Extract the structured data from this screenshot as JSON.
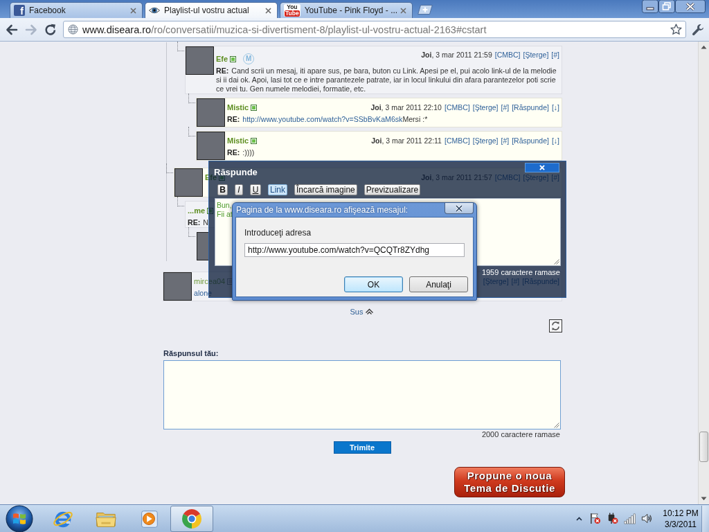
{
  "browser": {
    "tabs": [
      {
        "title": "Facebook",
        "selected": false,
        "favicon": {
          "kind": "letter",
          "text": "f"
        }
      },
      {
        "title": "Playlist-ul vostru actual",
        "selected": true,
        "favicon": {
          "kind": "eye"
        }
      },
      {
        "title": "YouTube - Pink Floyd - ...",
        "selected": false,
        "favicon": {
          "kind": "stacked",
          "lines": [
            "You",
            "Tube"
          ]
        }
      }
    ],
    "navigation": [
      {
        "kind": "back",
        "disabled": false
      },
      {
        "kind": "forward",
        "disabled": true
      },
      {
        "kind": "reload",
        "disabled": false
      }
    ],
    "address": {
      "host": "www.diseara.ro",
      "path": "/ro/conversatii/muzica-si-divertisment-8/playlist-ul-vostru-actual-2163#cstart"
    }
  },
  "thread": [
    {
      "kind": "continued",
      "children": [
        {
          "kind": "continued",
          "children": [
            {
              "kind": "comment",
              "avatar": true,
              "author": "Efe",
              "online": true,
              "badge": "M",
              "date": "**Joi**, 3 mar 2011 21:59",
              "links": [
                "[CMBC]",
                "[Şterge]",
                "[#]"
              ],
              "body": {
                "prefix": "RE:",
                "text": "Cand scrii un mesaj, iti apare sus, pe bara, buton cu Link. Apesi pe el, pui acolo link-ul de la melodie si ii dai ok. Apoi, lasi tot ce e intre parantezele patrate, iar in locul linkului din afara parantezelor poti scrie ce vrei tu. Gen numele melodiei, formatie, etc."
              },
              "children": [
                {
                  "kind": "comment",
                  "avatar": true,
                  "author": "Mistic",
                  "online": true,
                  "date": "**Joi**, 3 mar 2011 22:10",
                  "links": [
                    "[CMBC]",
                    "[Şterge]",
                    "[#]",
                    "[Răspunde]",
                    "[↓]"
                  ],
                  "body": {
                    "prefix": "RE:",
                    "link": "http://www.youtube.com/watch?v=SSbBvKaM6sk",
                    "text": "Mersi :*"
                  }
                },
                {
                  "kind": "comment",
                  "avatar": true,
                  "author": "Mistic",
                  "online": true,
                  "date": "**Joi**, 3 mar 2011 22:11",
                  "links": [
                    "[CMBC]",
                    "[Şterge]",
                    "[#]",
                    "[Răspunde]",
                    "[↓]"
                  ],
                  "body": {
                    "prefix": "RE:",
                    "text": ":))))"
                  }
                }
              ]
            }
          ]
        },
        {
          "kind": "comment",
          "avatar": true,
          "author": "Efe",
          "online": true,
          "date": "**Joi**, 3 mar 2011 21:57",
          "links": [
            "[CMBC]",
            "[Şterge]",
            "[#]"
          ],
          "children": [
            {
              "kind": "comment",
              "avatar": false,
              "author": "...me",
              "online": true,
              "body": {
                "prefix": "RE:",
                "text": "N"
              },
              "children": [
                {
                  "kind": "comment",
                  "avatar": true
                }
              ]
            }
          ]
        }
      ]
    },
    {
      "kind": "comment",
      "avatar": true,
      "author": "mircea04",
      "online": false,
      "links": [
        "[Şterge]",
        "[#]",
        "[Răspunde]"
      ],
      "body": {
        "link": "alone"
      }
    }
  ],
  "reply_dialog": {
    "title": "Răspunde",
    "tools": [
      {
        "label": "B",
        "kind": "bold",
        "pressed": false
      },
      {
        "label": "I",
        "kind": "italic",
        "pressed": false
      },
      {
        "label": "U",
        "kind": "underline",
        "pressed": false
      },
      {
        "label": "Link",
        "kind": "plain",
        "pressed": true
      },
      {
        "label": "Încarcă imagine",
        "kind": "plain",
        "pressed": false
      },
      {
        "label": "Previzualizare",
        "kind": "plain",
        "pressed": false
      }
    ],
    "value_lines": [
      "Bun,",
      "Fii at"
    ],
    "counter": "1959 caractere ramase"
  },
  "prompt": {
    "title": "Pagina de la www.diseara.ro afişează mesajul:",
    "label": "Introduceţi adresa",
    "value": "http://www.youtube.com/watch?v=QCQTr8ZYdhg",
    "buttons": [
      {
        "label": "OK",
        "default": true
      },
      {
        "label": "Anulaţi",
        "default": false
      }
    ]
  },
  "page": {
    "top_link": "Sus",
    "reply_label": "Răspunsul tău:",
    "counter": "2000 caractere ramase",
    "submit": "Trimite",
    "new_topic": [
      "Propune o noua",
      "Tema de Discutie"
    ]
  },
  "taskbar": {
    "apps": [
      {
        "kind": "globe",
        "active": false
      },
      {
        "kind": "folder",
        "active": false
      },
      {
        "kind": "media",
        "active": false
      },
      {
        "kind": "ball",
        "active": true
      }
    ],
    "clock": {
      "time": "10:12 PM",
      "date": "3/3/2011"
    }
  }
}
